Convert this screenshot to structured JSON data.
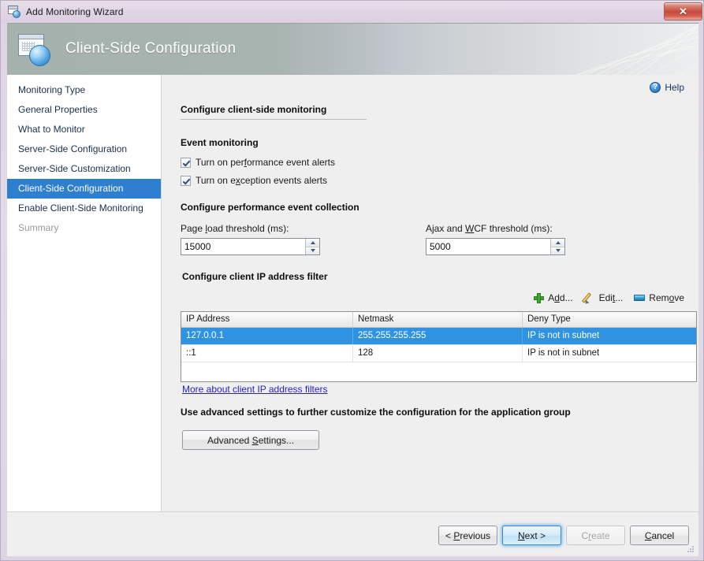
{
  "window": {
    "title": "Add Monitoring Wizard",
    "close_label": "✕"
  },
  "banner": {
    "title": "Client-Side Configuration"
  },
  "sidebar": {
    "items": [
      {
        "label": "Monitoring Type",
        "state": "normal"
      },
      {
        "label": "General Properties",
        "state": "normal"
      },
      {
        "label": "What to Monitor",
        "state": "normal"
      },
      {
        "label": "Server-Side Configuration",
        "state": "normal"
      },
      {
        "label": "Server-Side Customization",
        "state": "normal"
      },
      {
        "label": "Client-Side Configuration",
        "state": "selected"
      },
      {
        "label": "Enable Client-Side Monitoring",
        "state": "normal"
      },
      {
        "label": "Summary",
        "state": "disabled"
      }
    ]
  },
  "help": {
    "label": "Help",
    "glyph": "?"
  },
  "main": {
    "page_heading": "Configure client-side monitoring",
    "event_monitoring": {
      "heading": "Event monitoring",
      "checkboxes": [
        {
          "label_before": "Turn on per",
          "accel": "f",
          "label_after": "ormance event alerts",
          "checked": true
        },
        {
          "label_before": "Turn on e",
          "accel": "x",
          "label_after": "ception events alerts",
          "checked": true
        }
      ]
    },
    "performance_collection": {
      "heading": "Configure performance event collection",
      "page_load": {
        "label_before": "Page ",
        "accel": "l",
        "label_after": "oad threshold (ms):",
        "value": "15000"
      },
      "ajax_wcf": {
        "label_before": "Ajax and ",
        "accel": "W",
        "label_after": "CF threshold (ms):",
        "value": "5000"
      }
    },
    "ip_filter": {
      "heading": "Configure client IP address filter",
      "toolbar": [
        {
          "icon": "add-icon",
          "label_before": "A",
          "accel": "d",
          "label_after": "d..."
        },
        {
          "icon": "edit-icon",
          "label_before": "Edi",
          "accel": "t",
          "label_after": "..."
        },
        {
          "icon": "remove-icon",
          "label_before": "Rem",
          "accel": "o",
          "label_after": "ve"
        }
      ],
      "columns": [
        "IP Address",
        "Netmask",
        "Deny Type"
      ],
      "rows": [
        {
          "cells": [
            "127.0.0.1",
            "255.255.255.255",
            "IP is not in subnet"
          ],
          "selected": true
        },
        {
          "cells": [
            "::1",
            "128",
            "IP is not in subnet"
          ],
          "selected": false
        }
      ],
      "more_link": "More about client IP address filters"
    },
    "advanced": {
      "heading": "Use advanced settings to further customize the configuration for the application group",
      "button": {
        "label_before": "Advanced ",
        "accel": "S",
        "label_after": "ettings..."
      }
    }
  },
  "footer": {
    "buttons": [
      {
        "name": "previous",
        "label_before": "< ",
        "accel": "P",
        "label_after": "revious",
        "state": "normal"
      },
      {
        "name": "next",
        "label_before": "",
        "accel": "N",
        "label_after": "ext >",
        "state": "default"
      },
      {
        "name": "create",
        "label_before": "C",
        "accel": "r",
        "label_after": "eate",
        "state": "disabled"
      },
      {
        "name": "cancel",
        "label_before": "",
        "accel": "C",
        "label_after": "ancel",
        "state": "normal"
      }
    ]
  },
  "colors": {
    "selection_blue": "#2f7fd0",
    "grid_selection_blue": "#2f93e4",
    "link_blue": "#2222cc",
    "accent_green": "#3fa72f",
    "close_red": "#c8483a"
  }
}
